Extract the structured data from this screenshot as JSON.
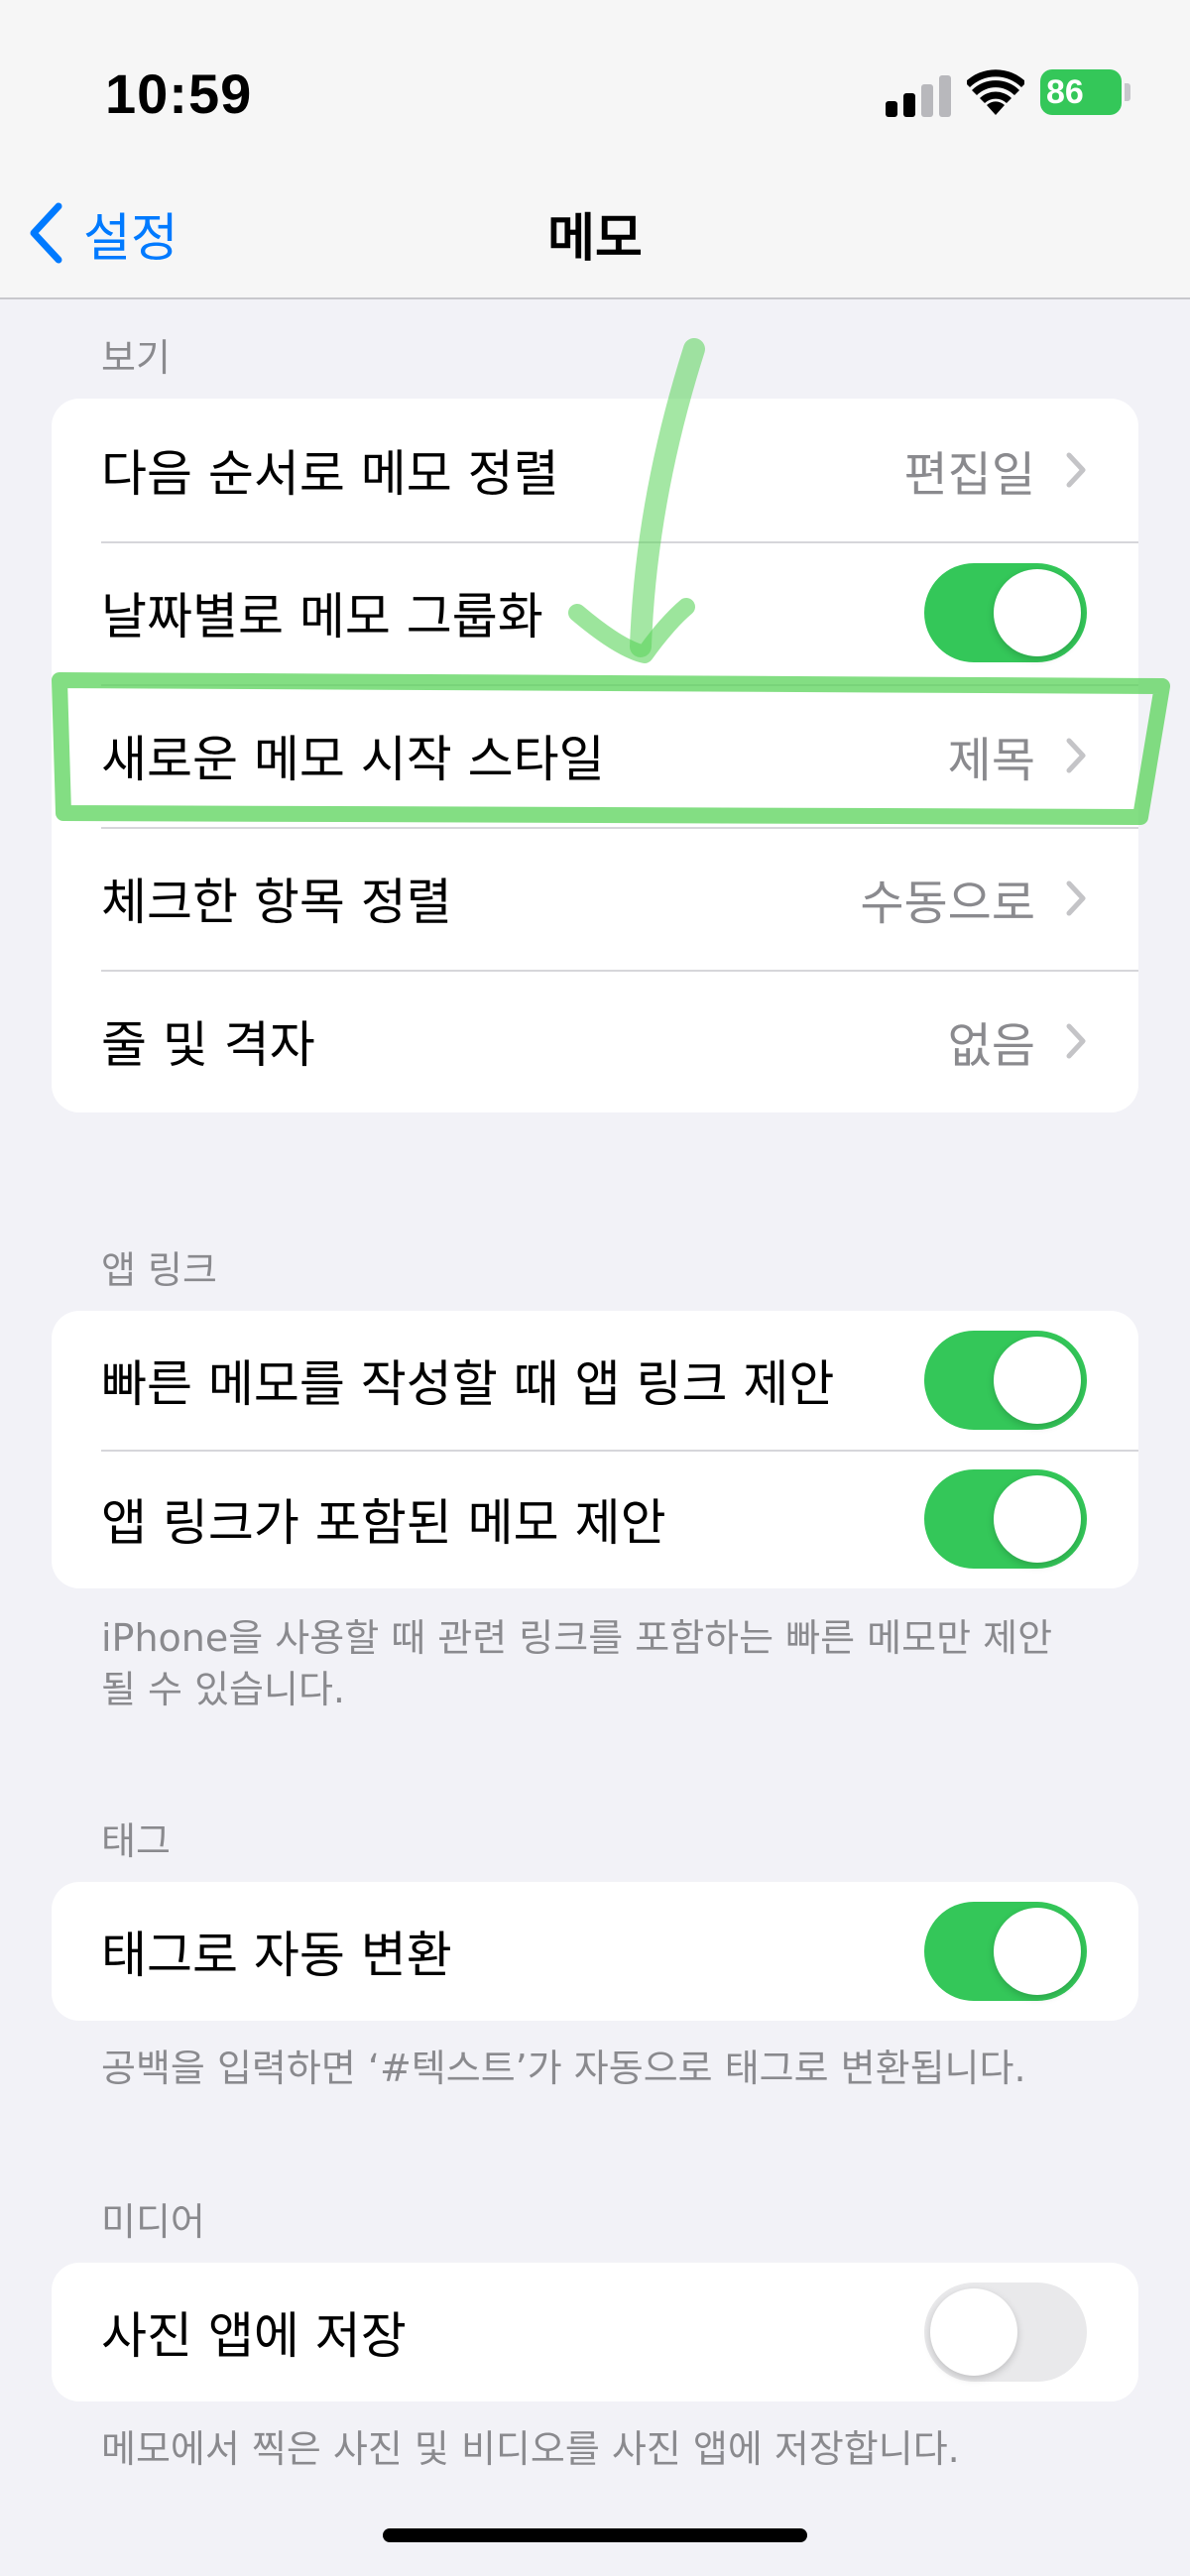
{
  "status_bar": {
    "time": "10:59",
    "battery": "86"
  },
  "nav": {
    "back_label": "설정",
    "title": "메모"
  },
  "sections": {
    "view": {
      "header": "보기",
      "rows": [
        {
          "label": "다음 순서로 메모 정렬",
          "value": "편집일"
        },
        {
          "label": "날짜별로 메모 그룹화",
          "toggle": true
        },
        {
          "label": "새로운 메모 시작 스타일",
          "value": "제목"
        },
        {
          "label": "체크한 항목 정렬",
          "value": "수동으로"
        },
        {
          "label": "줄 및 격자",
          "value": "없음"
        }
      ]
    },
    "app_links": {
      "header": "앱 링크",
      "rows": [
        {
          "label": "빠른 메모를 작성할 때 앱 링크 제안",
          "toggle": true
        },
        {
          "label": "앱 링크가 포함된 메모 제안",
          "toggle": true
        }
      ],
      "footer": "iPhone을 사용할 때 관련 링크를 포함하는 빠른 메모만 제안될 수 있습니다."
    },
    "tags": {
      "header": "태그",
      "rows": [
        {
          "label": "태그로 자동 변환",
          "toggle": true
        }
      ],
      "footer": "공백을 입력하면 ‘#텍스트’가 자동으로 태그로 변환됩니다."
    },
    "media": {
      "header": "미디어",
      "rows": [
        {
          "label": "사진 앱에 저장",
          "toggle": false
        }
      ],
      "footer": "메모에서 찍은 사진 및 비디오를 사진 앱에 저장합니다."
    }
  },
  "colors": {
    "accent": "#007aff",
    "toggle_on": "#34c759",
    "annotation": "#5ad35a"
  }
}
